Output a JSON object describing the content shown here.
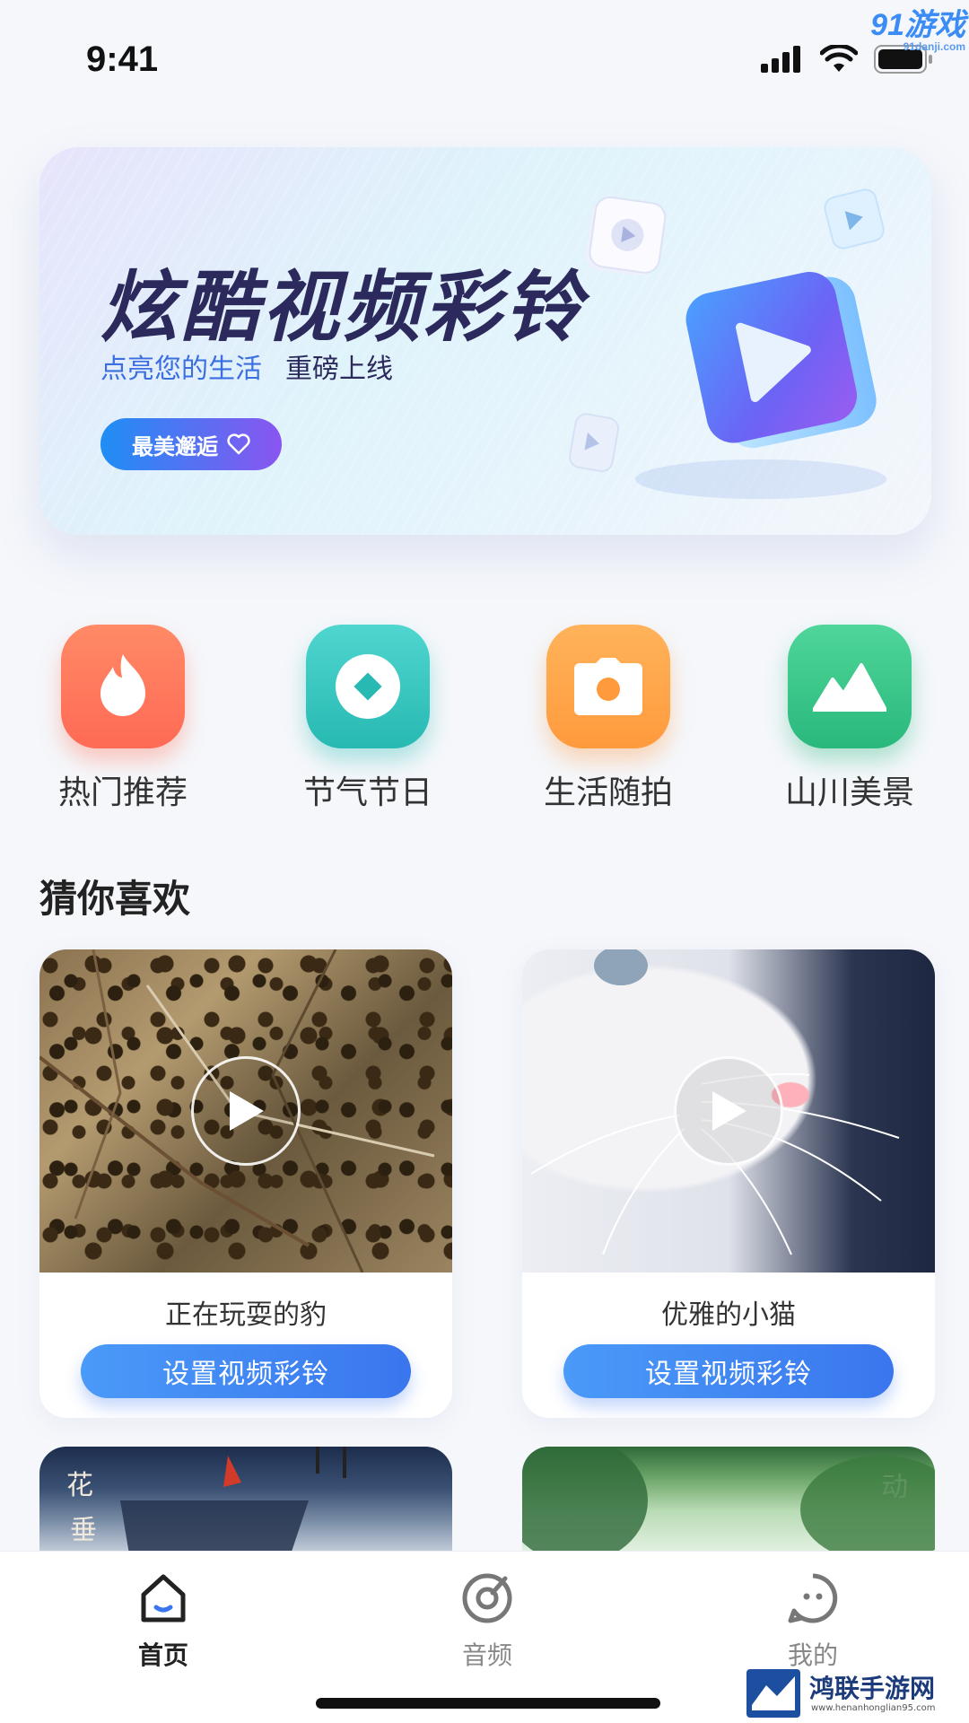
{
  "status": {
    "time": "9:41"
  },
  "watermarks": {
    "top_brand": "91游戏",
    "top_url": "91danji.com",
    "bottom_brand": "鸿联手游网",
    "bottom_url": "www.henanhonglian95.com"
  },
  "banner": {
    "title": "炫酷视频彩铃",
    "subtitle_a": "点亮您的生活",
    "subtitle_b": "重磅上线",
    "button": "最美邂逅"
  },
  "categories": [
    {
      "label": "热门推荐",
      "icon": "flame-icon"
    },
    {
      "label": "节气节日",
      "icon": "diamond-icon"
    },
    {
      "label": "生活随拍",
      "icon": "camera-icon"
    },
    {
      "label": "山川美景",
      "icon": "mountain-icon"
    }
  ],
  "section": {
    "title": "猜你喜欢"
  },
  "cards": [
    {
      "title": "正在玩耍的豹",
      "button": "设置视频彩铃"
    },
    {
      "title": "优雅的小猫",
      "button": "设置视频彩铃"
    }
  ],
  "partial_cards": [
    {
      "text_1": "花",
      "text_2": "垂"
    },
    {
      "text_1": "动"
    }
  ],
  "tabs": [
    {
      "label": "首页",
      "icon": "home-icon",
      "active": true
    },
    {
      "label": "音频",
      "icon": "audio-icon",
      "active": false
    },
    {
      "label": "我的",
      "icon": "profile-icon",
      "active": false
    }
  ],
  "colors": {
    "accent": "#3a76ee",
    "banner_title": "#2c2a5c"
  }
}
